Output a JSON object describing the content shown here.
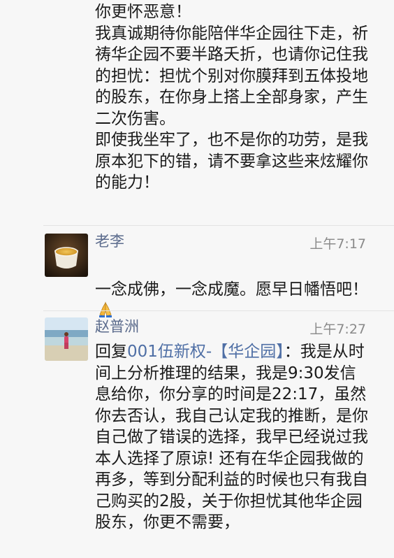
{
  "messages": [
    {
      "text": "你更怀恶意！\n我真诚期待你能陪伴华企园往下走，祈祷华企园不要半路夭折，也请你记住我的担忧：担忧个别对你膜拜到五体投地的股东，在你身上搭上全部身家，产生二次伤害。\n即使我坐牢了，也不是你的功劳，是我原本犯下的错，请不要拿这些来炫耀你的能力！"
    },
    {
      "sender": "老李",
      "time": "上午7:17",
      "text": "一念成佛，一念成魔。愿早日幡悟吧！",
      "emoji": "pray-icon"
    },
    {
      "sender": "赵普洲",
      "time": "上午7:27",
      "reply_prefix": "回复",
      "reply_name": "001伍新权-【华企园】",
      "text": "：我是从时间上分析推理的结果，我是9:30发信息给你，你分享的时间是22:17，虽然你去否认，我自己认定我的推断，是你自己做了错误的选择，我早已经说过我本人选择了原谅! 还有在华企园我做的再多，等到分配利益的时候也只有我自己购买的2股，关于你担忧其他华企园股东，你更不需要，"
    }
  ],
  "colors": {
    "background": "#f7f7f7",
    "sender_name": "#5b6b8c",
    "reply_link": "#4f6fa5",
    "timestamp": "#8a8a8a"
  }
}
